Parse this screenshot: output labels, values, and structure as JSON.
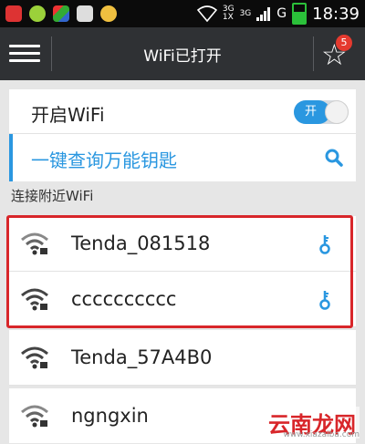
{
  "status_bar": {
    "network_small_top": "3G",
    "network_small_mid": "3G",
    "network_small_bottom": "1X",
    "carrier": "G",
    "time": "18:39",
    "icons": [
      "red-app-icon",
      "green-app-icon",
      "colorful-app-icon",
      "image-icon",
      "weather-icon",
      "wifi-icon",
      "signal-icon",
      "battery-icon"
    ]
  },
  "top_bar": {
    "title": "WiFi已打开",
    "badge_count": "5",
    "icons": [
      "menu-icon",
      "star-icon"
    ]
  },
  "wifi_toggle": {
    "label": "开启WiFi",
    "state_label": "开"
  },
  "search_row": {
    "label": "一键查询万能钥匙",
    "icon": "search-icon"
  },
  "section": {
    "title": "连接附近WiFi"
  },
  "networks": [
    {
      "name": "Tenda_081518",
      "has_key": true
    },
    {
      "name": "cccccccccc",
      "has_key": true
    },
    {
      "name": "Tenda_57A4B0",
      "has_key": false
    },
    {
      "name": "ngngxin",
      "has_key": false
    }
  ],
  "watermark": {
    "logo": "云南龙网",
    "url": "www.xiazaiba.com"
  },
  "colors": {
    "accent": "#2a97e0",
    "topbar": "#2f3134",
    "highlight": "#d8262a"
  }
}
